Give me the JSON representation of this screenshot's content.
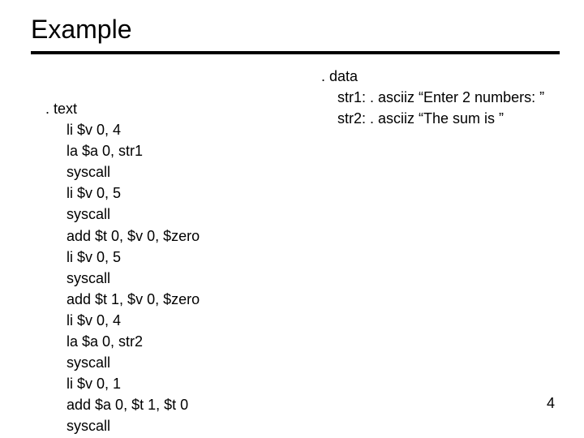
{
  "title": "Example",
  "left": {
    "section": ". text",
    "lines": [
      "li   $v 0, 4",
      "la  $a 0, str1",
      "syscall",
      "li   $v 0, 5",
      "syscall",
      "add  $t 0, $v 0, $zero",
      "li   $v 0, 5",
      "syscall",
      "add  $t 1, $v 0, $zero",
      "li   $v 0, 4",
      "la  $a 0, str2",
      "syscall",
      "li    $v 0, 1",
      "add  $a 0, $t 1, $t 0",
      "syscall"
    ]
  },
  "right": {
    "section": ". data",
    "lines": [
      "str1:  . asciiz  “Enter 2 numbers: ”",
      "str2:  . asciiz  “The sum is ”"
    ]
  },
  "page_number": "4"
}
